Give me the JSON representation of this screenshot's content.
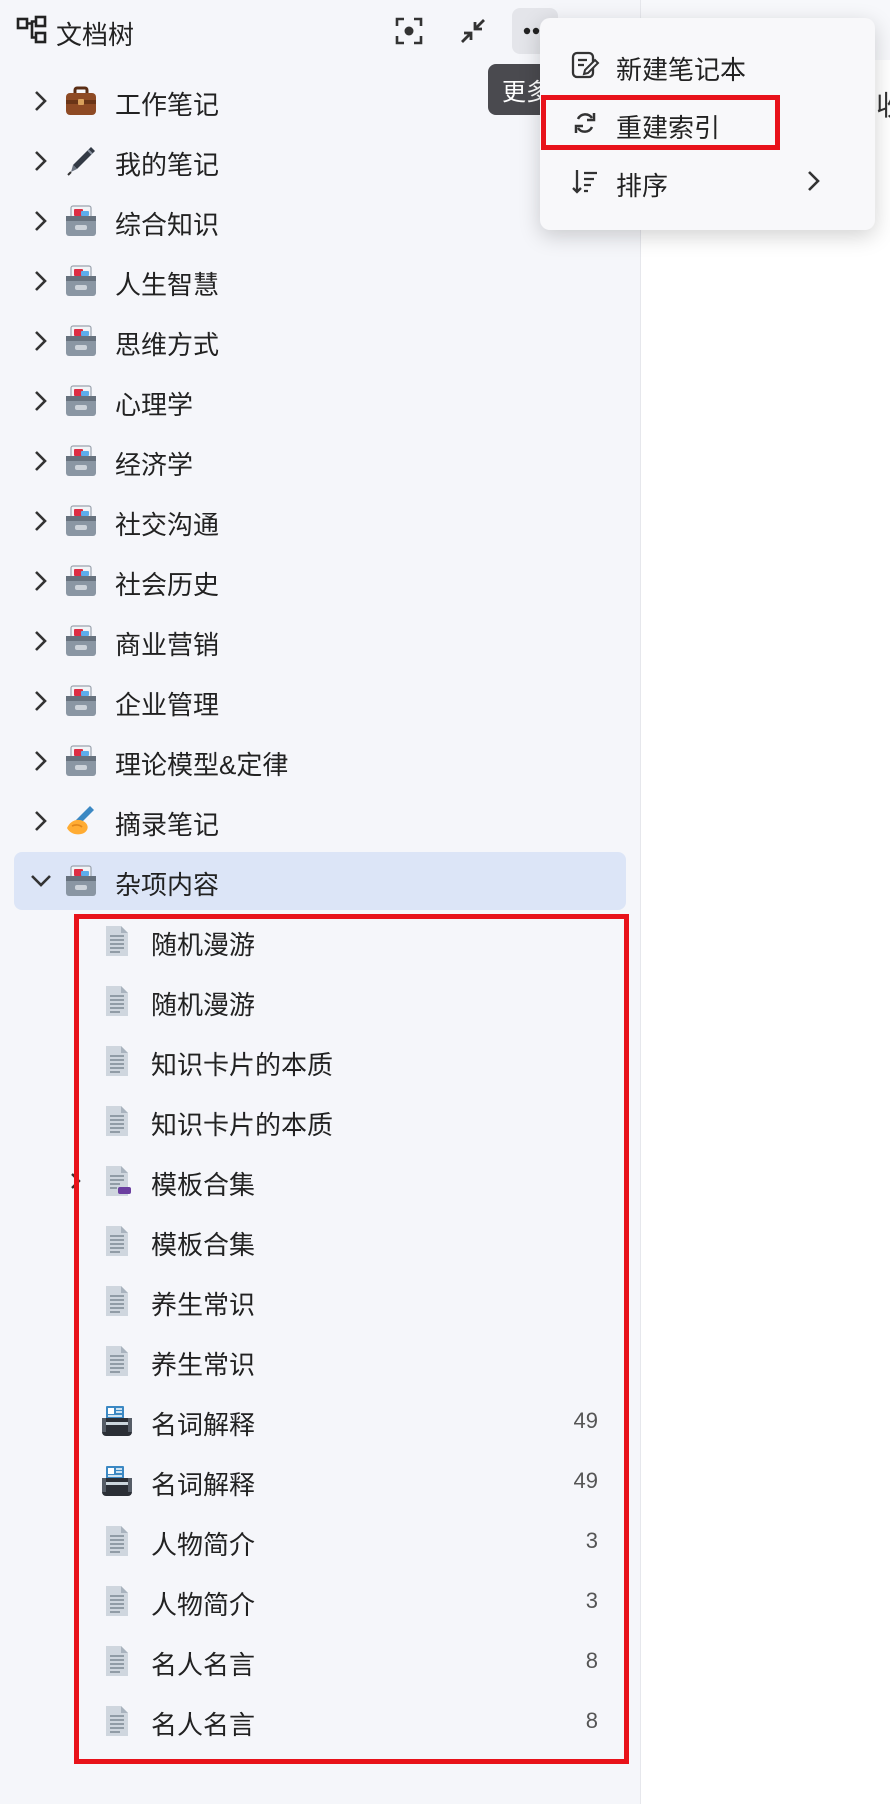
{
  "header": {
    "title": "文档树",
    "tooltip": "更多"
  },
  "menu": {
    "items": [
      {
        "label": "新建笔记本",
        "icon": "edit-notebook-icon"
      },
      {
        "label": "重建索引",
        "icon": "refresh-icon"
      },
      {
        "label": "排序",
        "icon": "sort-icon",
        "submenu": true
      }
    ]
  },
  "tree": {
    "notebooks": [
      {
        "label": "工作笔记",
        "icon": "briefcase-icon"
      },
      {
        "label": "我的笔记",
        "icon": "pen-icon"
      },
      {
        "label": "综合知识",
        "icon": "card-file-box-icon"
      },
      {
        "label": "人生智慧",
        "icon": "card-file-box-icon"
      },
      {
        "label": "思维方式",
        "icon": "card-file-box-icon"
      },
      {
        "label": "心理学",
        "icon": "card-file-box-icon"
      },
      {
        "label": "经济学",
        "icon": "card-file-box-icon"
      },
      {
        "label": "社交沟通",
        "icon": "card-file-box-icon"
      },
      {
        "label": "社会历史",
        "icon": "card-file-box-icon"
      },
      {
        "label": "商业营销",
        "icon": "card-file-box-icon"
      },
      {
        "label": "企业管理",
        "icon": "card-file-box-icon"
      },
      {
        "label": "理论模型&定律",
        "icon": "card-file-box-icon"
      },
      {
        "label": "摘录笔记",
        "icon": "writing-hand-icon"
      },
      {
        "label": "杂项内容",
        "icon": "card-file-box-icon",
        "expanded": true,
        "selected": true
      }
    ],
    "children": [
      {
        "label": "随机漫游",
        "icon": "document-icon",
        "count": ""
      },
      {
        "label": "随机漫游",
        "icon": "document-icon",
        "count": ""
      },
      {
        "label": "知识卡片的本质",
        "icon": "document-icon",
        "count": ""
      },
      {
        "label": "知识卡片的本质",
        "icon": "document-icon",
        "count": ""
      },
      {
        "label": "模板合集",
        "icon": "document-tagged-icon",
        "count": "",
        "hasChildren": true
      },
      {
        "label": "模板合集",
        "icon": "document-icon",
        "count": ""
      },
      {
        "label": "养生常识",
        "icon": "document-icon",
        "count": ""
      },
      {
        "label": "养生常识",
        "icon": "document-icon",
        "count": ""
      },
      {
        "label": "名词解释",
        "icon": "card-box-icon",
        "count": "49"
      },
      {
        "label": "名词解释",
        "icon": "card-box-icon",
        "count": "49"
      },
      {
        "label": "人物简介",
        "icon": "document-icon",
        "count": "3"
      },
      {
        "label": "人物简介",
        "icon": "document-icon",
        "count": "3"
      },
      {
        "label": "名人名言",
        "icon": "document-icon",
        "count": "8"
      },
      {
        "label": "名人名言",
        "icon": "document-icon",
        "count": "8"
      }
    ]
  },
  "right_panel": {
    "fragment": "收"
  },
  "colors": {
    "highlight": "#e8121a",
    "selected_row": "#dce5f7",
    "accent": "#3573f0"
  }
}
